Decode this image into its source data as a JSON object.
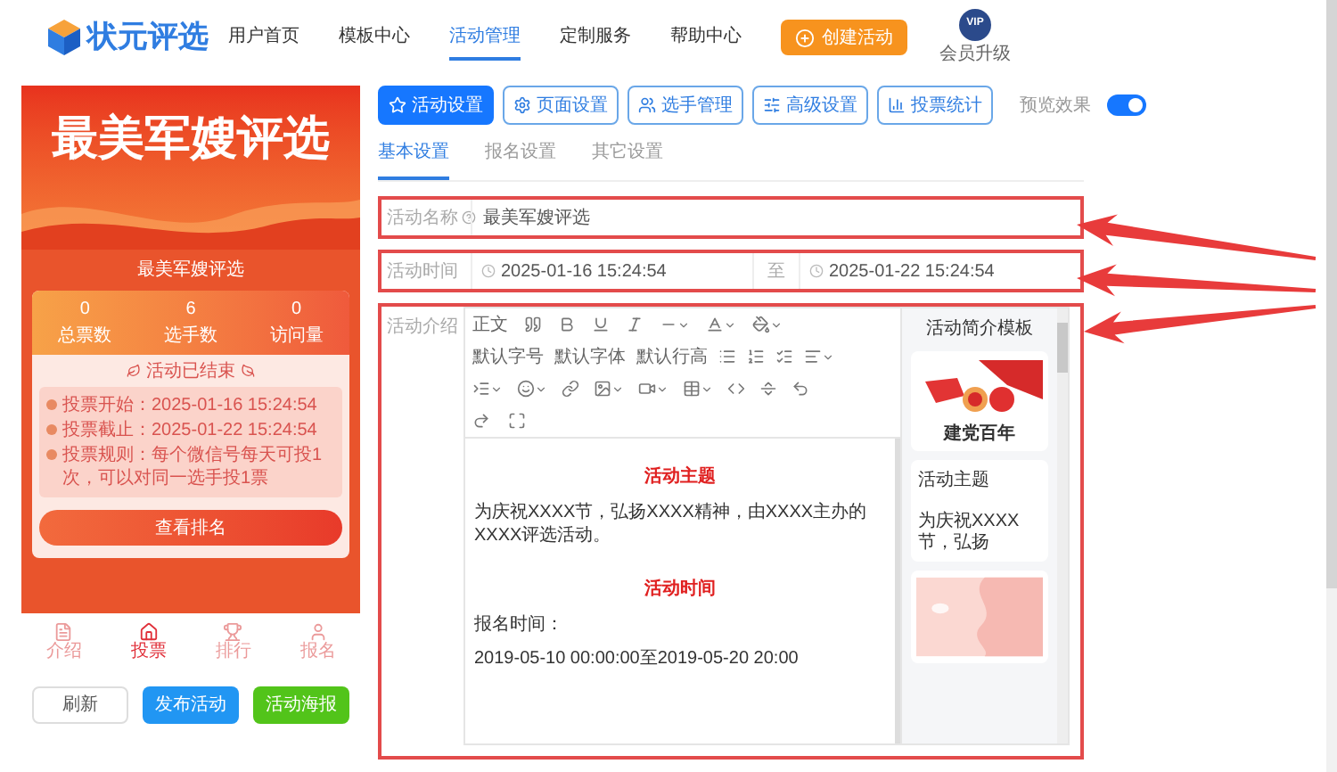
{
  "header": {
    "logo": "状元评选",
    "nav": [
      {
        "label": "用户首页",
        "selected": false
      },
      {
        "label": "模板中心",
        "selected": false
      },
      {
        "label": "活动管理",
        "selected": true
      },
      {
        "label": "定制服务",
        "selected": false
      },
      {
        "label": "帮助中心",
        "selected": false
      }
    ],
    "create_button": "创建活动",
    "vip_badge": "VIP",
    "vip_label": "会员升级"
  },
  "preview": {
    "banner_title": "最美军嫂评选",
    "subtitle": "最美军嫂评选",
    "stats": [
      {
        "value": "0",
        "label": "总票数"
      },
      {
        "value": "6",
        "label": "选手数"
      },
      {
        "value": "0",
        "label": "访问量"
      }
    ],
    "status": "活动已结束",
    "info": [
      "投票开始：2025-01-16 15:24:54",
      "投票截止：2025-01-22 15:24:54",
      "投票规则：每个微信号每天可投1次，可以对同一选手投1票"
    ],
    "rank_button": "查看排名",
    "bottom_nav": [
      {
        "label": "介绍",
        "selected": false
      },
      {
        "label": "投票",
        "selected": true
      },
      {
        "label": "排行",
        "selected": false
      },
      {
        "label": "报名",
        "selected": false
      }
    ]
  },
  "actions": [
    {
      "label": "刷新",
      "kind": "outline"
    },
    {
      "label": "发布活动",
      "kind": "primary"
    },
    {
      "label": "活动海报",
      "kind": "success"
    }
  ],
  "toolbar": {
    "buttons": [
      {
        "label": "活动设置",
        "selected": true
      },
      {
        "label": "页面设置",
        "selected": false
      },
      {
        "label": "选手管理",
        "selected": false
      },
      {
        "label": "高级设置",
        "selected": false
      },
      {
        "label": "投票统计",
        "selected": false
      }
    ],
    "preview_label": "预览效果",
    "preview_on": true
  },
  "tabs": [
    {
      "label": "基本设置",
      "selected": true
    },
    {
      "label": "报名设置",
      "selected": false
    },
    {
      "label": "其它设置",
      "selected": false
    }
  ],
  "form": {
    "name_label": "活动名称",
    "name_value": "最美军嫂评选",
    "time_label": "活动时间",
    "start": "2025-01-16 15:24:54",
    "separator": "至",
    "end": "2025-01-22 15:24:54",
    "intro_label": "活动介绍"
  },
  "editor": {
    "format_select": "正文",
    "size_select": "默认字号",
    "font_select": "默认字体",
    "line_height_select": "默认行高",
    "content": [
      {
        "kind": "heading",
        "text": "活动主题"
      },
      {
        "kind": "paragraph",
        "text": "为庆祝XXXX节，弘扬XXXX精神，由XXXX主办的XXXX评选活动。"
      },
      {
        "kind": "heading",
        "text": "活动时间"
      },
      {
        "kind": "paragraph",
        "text": "报名时间："
      },
      {
        "kind": "paragraph",
        "text": "2019-05-10 00:00:00至2019-05-20 20:00"
      }
    ]
  },
  "templates": {
    "title": "活动简介模板",
    "cards": [
      {
        "kind": "party",
        "caption": "建党百年"
      },
      {
        "kind": "text",
        "title": "活动主题",
        "snippet": "为庆祝XXXX节，弘扬"
      },
      {
        "kind": "pink"
      }
    ]
  }
}
